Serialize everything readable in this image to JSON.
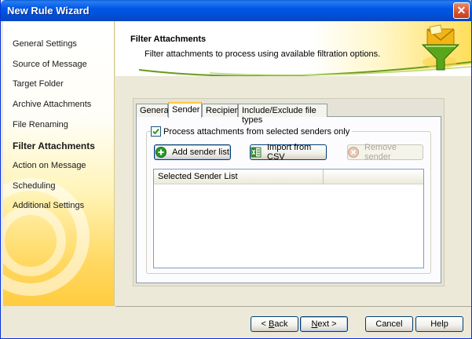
{
  "window": {
    "title": "New Rule Wizard"
  },
  "sidebar": {
    "items": [
      {
        "label": "General Settings",
        "active": false
      },
      {
        "label": "Source of Message",
        "active": false
      },
      {
        "label": "Target Folder",
        "active": false
      },
      {
        "label": "Archive Attachments",
        "active": false
      },
      {
        "label": "File Renaming",
        "active": false
      },
      {
        "label": "Filter Attachments",
        "active": true
      },
      {
        "label": "Action on Message",
        "active": false
      },
      {
        "label": "Scheduling",
        "active": false
      },
      {
        "label": "Additional Settings",
        "active": false
      }
    ]
  },
  "header": {
    "title": "Filter Attachments",
    "subtitle": "Filter attachments to process using available filtration options.",
    "icon": "funnel-envelope-icon"
  },
  "tabs": [
    {
      "label": "General",
      "active": false
    },
    {
      "label": "Sender",
      "active": true
    },
    {
      "label": "Recipient",
      "active": false
    },
    {
      "label": "Include/Exclude file types",
      "active": false
    }
  ],
  "sender_tab": {
    "checkbox_label": "Process attachments from selected  senders only",
    "checkbox_checked": true,
    "add_button": "Add sender list",
    "import_button": "Import from CSV",
    "remove_button": "Remove sender",
    "list_columns": [
      "Selected Sender List",
      ""
    ],
    "list_rows": []
  },
  "footer": {
    "back_prefix": "< ",
    "back_key": "B",
    "back_rest": "ack",
    "next_key": "N",
    "next_rest": "ext >",
    "cancel": "Cancel",
    "help": "Help"
  },
  "colors": {
    "titlebar": "#0058e6",
    "sidebar_accent": "#ffcc40",
    "tab_highlight": "#ffc83c"
  }
}
